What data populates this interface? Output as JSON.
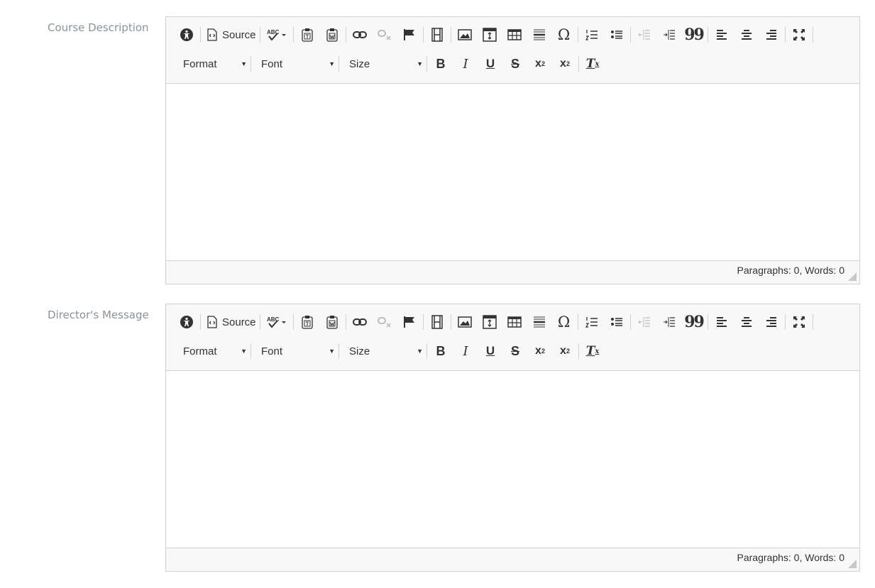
{
  "fields": [
    {
      "label": "Course Description",
      "source_label": "Source",
      "format_label": "Format",
      "font_label": "Font",
      "size_label": "Size",
      "status": "Paragraphs: 0, Words: 0"
    },
    {
      "label": "Director's Message",
      "source_label": "Source",
      "format_label": "Format",
      "font_label": "Font",
      "size_label": "Size",
      "status": "Paragraphs: 0, Words: 0"
    }
  ],
  "glyphs": {
    "abc": "ABC",
    "bold": "B",
    "italic": "I",
    "underline": "U",
    "strike": "S",
    "subscript": "x",
    "subscript_mark": "2",
    "superscript": "x",
    "superscript_mark": "2",
    "remove_format": "T",
    "remove_format_mark": "x",
    "blockquote": "99",
    "special_char": "Ω"
  },
  "icons": [
    "accessibility-icon",
    "source-icon",
    "spellcheck-icon",
    "paste-text-icon",
    "paste-word-icon",
    "link-icon",
    "unlink-icon",
    "anchor-flag-icon",
    "media-icon",
    "image-icon",
    "iframe-icon",
    "table-icon",
    "horizontal-rule-icon",
    "special-char-icon",
    "numbered-list-icon",
    "bulleted-list-icon",
    "outdent-icon",
    "indent-icon",
    "blockquote-icon",
    "align-left-icon",
    "align-center-icon",
    "align-right-icon",
    "maximize-icon"
  ]
}
